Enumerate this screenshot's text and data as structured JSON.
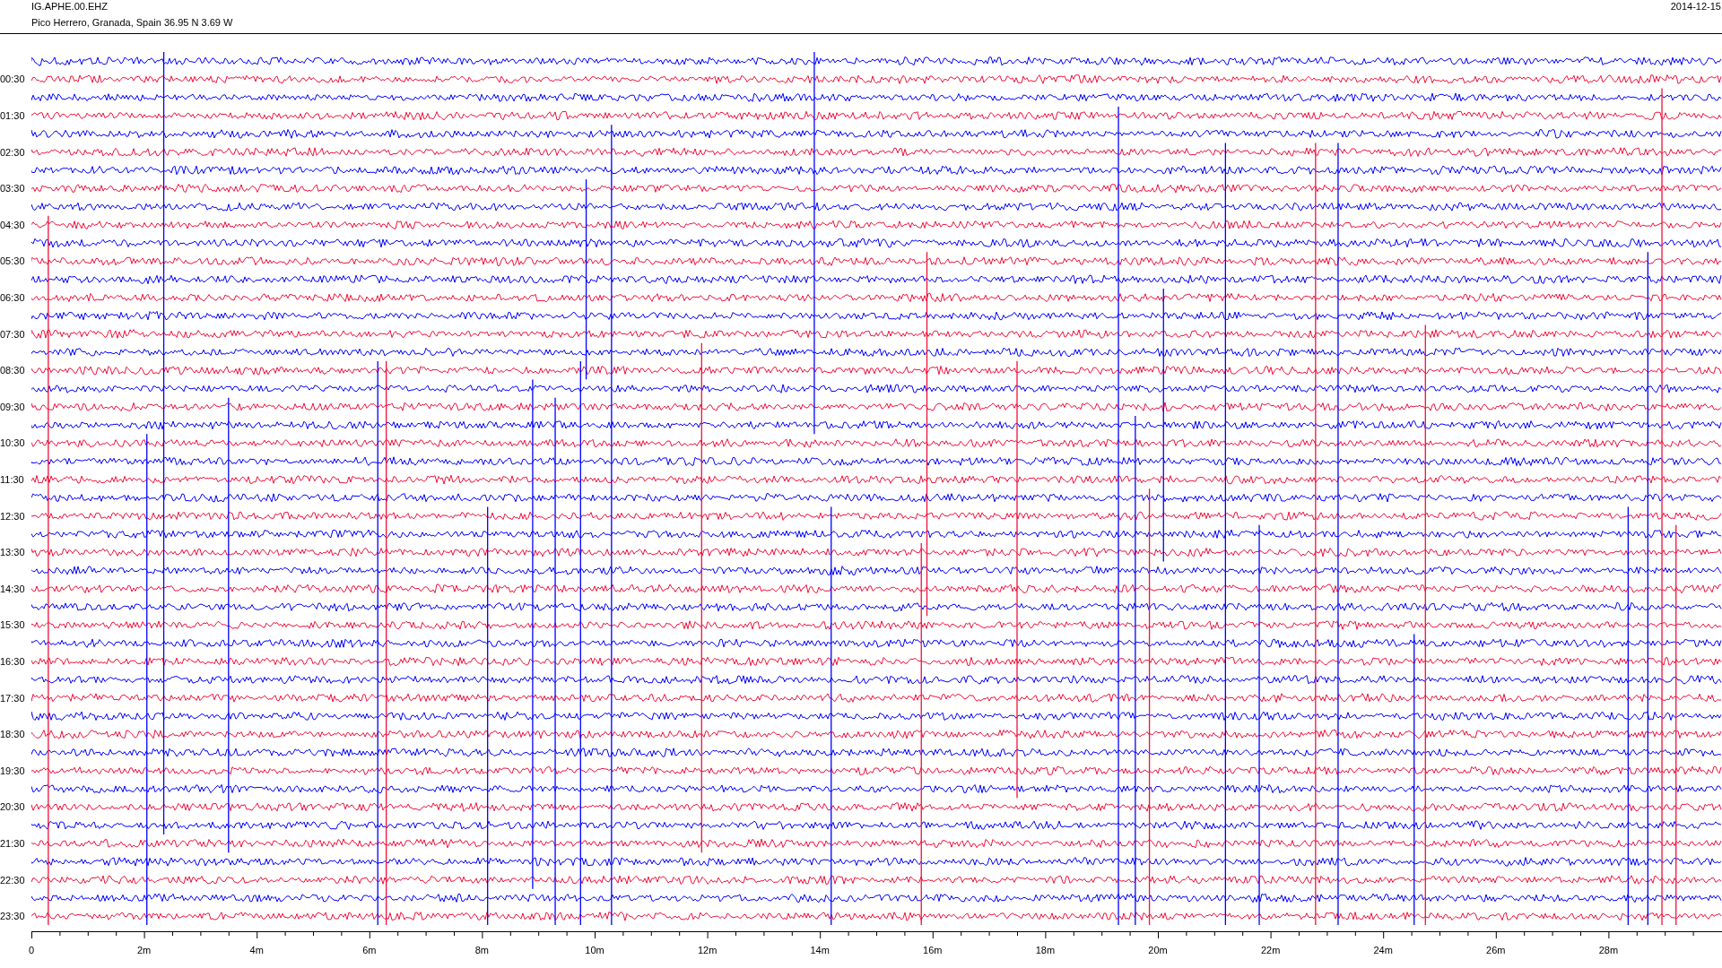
{
  "header": {
    "station": "IG.APHE.00.EHZ",
    "location": "Pico Herrero, Granada, Spain  36.95 N 3.69 W",
    "date": "2014-12-15"
  },
  "hour_labels": [
    "00:30",
    "01:30",
    "02:30",
    "03:30",
    "04:30",
    "05:30",
    "06:30",
    "07:30",
    "08:30",
    "09:30",
    "10:30",
    "11:30",
    "12:30",
    "13:30",
    "14:30",
    "15:30",
    "16:30",
    "17:30",
    "18:30",
    "19:30",
    "20:30",
    "21:30",
    "22:30",
    "23:30"
  ],
  "x_axis": {
    "tick_labels": [
      "0",
      "2m",
      "4m",
      "6m",
      "8m",
      "10m",
      "12m",
      "14m",
      "16m",
      "18m",
      "20m",
      "22m",
      "24m",
      "26m",
      "28m"
    ]
  }
}
